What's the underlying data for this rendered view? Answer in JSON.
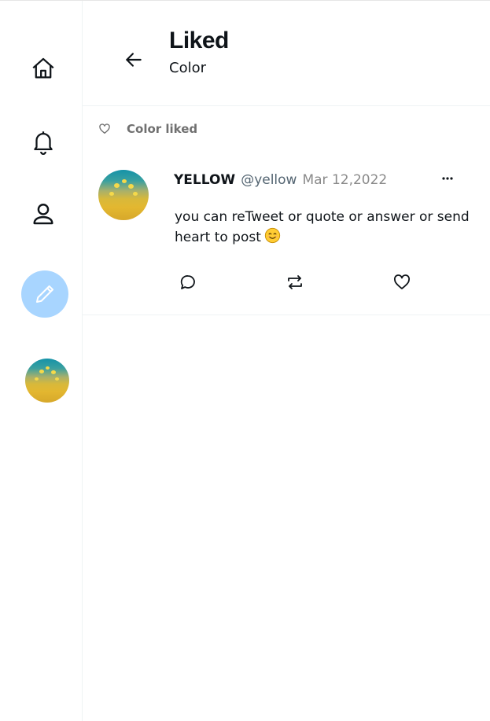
{
  "header": {
    "title": "Liked",
    "subtitle": "Color"
  },
  "sidebar": {
    "items": [
      {
        "name": "home",
        "icon": "home-icon"
      },
      {
        "name": "notifications",
        "icon": "bell-icon"
      },
      {
        "name": "profile",
        "icon": "user-icon"
      },
      {
        "name": "compose",
        "icon": "pencil-icon"
      },
      {
        "name": "account",
        "icon": "avatar"
      }
    ]
  },
  "liked_label": "Color liked",
  "tweet": {
    "name": "YELLOW",
    "handle": "@yellow",
    "date": "Mar 12,2022",
    "text": "you can reTweet or quote or answer or send heart to post",
    "emoji": "smiling-face-emoji"
  },
  "colors": {
    "compose_bg": "#a8d5ff",
    "divider": "#eff3f4",
    "muted": "#8a8a8a"
  }
}
